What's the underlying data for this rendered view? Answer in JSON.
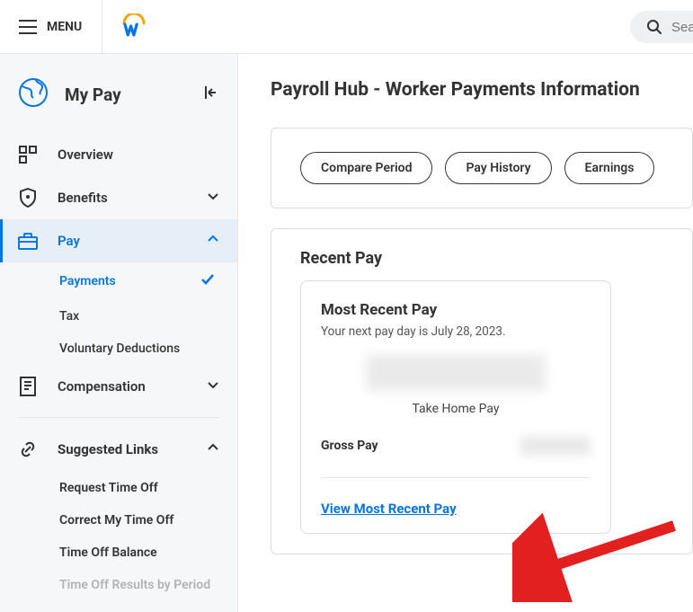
{
  "topbar": {
    "menu_label": "MENU",
    "search_placeholder": "Sea"
  },
  "sidebar": {
    "title": "My Pay",
    "nav": {
      "overview": "Overview",
      "benefits": "Benefits",
      "pay": "Pay",
      "pay_children": {
        "payments": "Payments",
        "tax": "Tax",
        "voluntary_deductions": "Voluntary Deductions"
      },
      "compensation": "Compensation"
    },
    "suggested": {
      "header": "Suggested Links",
      "links": {
        "request_time_off": "Request Time Off",
        "correct_my_time_off": "Correct My Time Off",
        "time_off_balance": "Time Off Balance",
        "time_off_results": "Time Off Results by Period"
      }
    }
  },
  "main": {
    "title": "Payroll Hub - Worker Payments Information",
    "pills": {
      "compare": "Compare Period",
      "history": "Pay History",
      "earnings": "Earnings"
    },
    "recent": {
      "section_title": "Recent Pay",
      "card_title": "Most Recent Pay",
      "next_pay": "Your next pay day is July 28, 2023.",
      "take_home": "Take Home Pay",
      "gross_label": "Gross Pay",
      "view_link": "View Most Recent Pay"
    }
  }
}
